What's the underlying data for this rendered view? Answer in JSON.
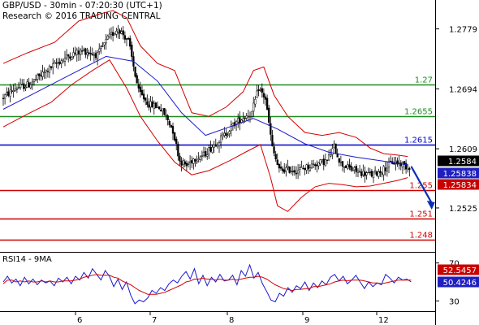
{
  "header": {
    "line1": "GBP/USD - 30min - 07:20:30 (UTC+1)",
    "line2": "Research © 2016 TRADING CENTRAL"
  },
  "colors": {
    "candles": "#000000",
    "bollinger_bands": "#d40000",
    "moving_average": "#1a1acc",
    "resistance_lines": "#1e8c1e",
    "pivot_line": "#0000cc",
    "support_lines": "#cc0000",
    "rsi": "#1a1acc",
    "rsi_ma": "#d40000",
    "price_tag": "#000000",
    "blue_tag": "#1f1fbf",
    "red_tag": "#c80000",
    "arrow": "#0a2fb5"
  },
  "chart_data": [
    {
      "type": "candlestick",
      "title": "",
      "y_axis": {
        "side": "right",
        "ticks": [
          1.2779,
          1.2694,
          1.2609,
          1.2525
        ],
        "tick_labels": [
          "1.2779",
          "1.2694",
          "1.2609",
          "1.2525"
        ],
        "range": [
          1.2465,
          1.282
        ]
      },
      "x_axis": {
        "categories": [
          "6",
          "7",
          "8",
          "9",
          "12"
        ]
      },
      "grid": false,
      "price_levels": [
        {
          "value": 1.27,
          "label": "1.27",
          "role": "resistance"
        },
        {
          "value": 1.2655,
          "label": "1.2655",
          "role": "resistance"
        },
        {
          "value": 1.2615,
          "label": "1.2615",
          "role": "pivot"
        },
        {
          "value": 1.255,
          "label": "1.255",
          "role": "support"
        },
        {
          "value": 1.251,
          "label": "1.251",
          "role": "support"
        },
        {
          "value": 1.248,
          "label": "1.248",
          "role": "support"
        }
      ],
      "price_tags": [
        {
          "label": "1.2584",
          "value": 1.2584,
          "style": "current-price"
        },
        {
          "label": "1.25838",
          "value": 1.25838,
          "style": "blue"
        },
        {
          "label": "1.25834",
          "value": 1.25834,
          "style": "red"
        }
      ],
      "price_path": [
        [
          0,
          1.268
        ],
        [
          8,
          1.2695
        ],
        [
          16,
          1.27
        ],
        [
          24,
          1.2715
        ],
        [
          32,
          1.273
        ],
        [
          40,
          1.2742
        ],
        [
          48,
          1.2748
        ],
        [
          56,
          1.2742
        ],
        [
          62,
          1.2765
        ],
        [
          68,
          1.278
        ],
        [
          74,
          1.2762
        ],
        [
          80,
          1.269
        ],
        [
          86,
          1.2672
        ],
        [
          92,
          1.2668
        ],
        [
          96,
          1.2655
        ],
        [
          100,
          1.2635
        ],
        [
          104,
          1.2592
        ],
        [
          108,
          1.2585
        ],
        [
          112,
          1.2595
        ],
        [
          118,
          1.26
        ],
        [
          124,
          1.2615
        ],
        [
          130,
          1.2628
        ],
        [
          136,
          1.2645
        ],
        [
          142,
          1.2655
        ],
        [
          146,
          1.266
        ],
        [
          150,
          1.2695
        ],
        [
          154,
          1.268
        ],
        [
          158,
          1.261
        ],
        [
          162,
          1.2578
        ],
        [
          166,
          1.258
        ],
        [
          172,
          1.2578
        ],
        [
          178,
          1.2583
        ],
        [
          184,
          1.2588
        ],
        [
          190,
          1.2592
        ],
        [
          194,
          1.2612
        ],
        [
          198,
          1.2588
        ],
        [
          204,
          1.258
        ],
        [
          210,
          1.2575
        ],
        [
          216,
          1.2572
        ],
        [
          222,
          1.2578
        ],
        [
          228,
          1.259
        ],
        [
          233,
          1.2588
        ],
        [
          236,
          1.2584
        ]
      ],
      "series": [
        {
          "name": "",
          "role": "moving-average",
          "points": [
            [
              0,
              1.2665
            ],
            [
              20,
              1.269
            ],
            [
              40,
              1.2715
            ],
            [
              60,
              1.274
            ],
            [
              76,
              1.2733
            ],
            [
              90,
              1.2705
            ],
            [
              104,
              1.266
            ],
            [
              118,
              1.2628
            ],
            [
              132,
              1.264
            ],
            [
              146,
              1.2652
            ],
            [
              160,
              1.2637
            ],
            [
              176,
              1.2616
            ],
            [
              190,
              1.2604
            ],
            [
              206,
              1.2597
            ],
            [
              220,
              1.2592
            ],
            [
              236,
              1.2586
            ]
          ]
        },
        {
          "name": "",
          "role": "bollinger-upper",
          "points": [
            [
              0,
              1.273
            ],
            [
              14,
              1.2745
            ],
            [
              30,
              1.276
            ],
            [
              44,
              1.279
            ],
            [
              56,
              1.28
            ],
            [
              64,
              1.2805
            ],
            [
              72,
              1.2795
            ],
            [
              80,
              1.2755
            ],
            [
              90,
              1.273
            ],
            [
              100,
              1.272
            ],
            [
              110,
              1.266
            ],
            [
              120,
              1.2655
            ],
            [
              130,
              1.2668
            ],
            [
              140,
              1.269
            ],
            [
              146,
              1.272
            ],
            [
              152,
              1.2725
            ],
            [
              158,
              1.2685
            ],
            [
              166,
              1.2655
            ],
            [
              176,
              1.2632
            ],
            [
              186,
              1.2628
            ],
            [
              196,
              1.2632
            ],
            [
              206,
              1.2625
            ],
            [
              214,
              1.261
            ],
            [
              222,
              1.2602
            ],
            [
              230,
              1.26
            ],
            [
              236,
              1.2598
            ]
          ]
        },
        {
          "name": "",
          "role": "bollinger-lower",
          "points": [
            [
              0,
              1.264
            ],
            [
              14,
              1.2658
            ],
            [
              28,
              1.2675
            ],
            [
              40,
              1.27
            ],
            [
              52,
              1.272
            ],
            [
              62,
              1.2735
            ],
            [
              72,
              1.2695
            ],
            [
              80,
              1.2655
            ],
            [
              90,
              1.262
            ],
            [
              100,
              1.259
            ],
            [
              110,
              1.2572
            ],
            [
              120,
              1.2578
            ],
            [
              132,
              1.2592
            ],
            [
              142,
              1.2605
            ],
            [
              150,
              1.2615
            ],
            [
              156,
              1.2568
            ],
            [
              160,
              1.2528
            ],
            [
              166,
              1.252
            ],
            [
              174,
              1.254
            ],
            [
              182,
              1.2555
            ],
            [
              190,
              1.256
            ],
            [
              198,
              1.2558
            ],
            [
              206,
              1.2555
            ],
            [
              214,
              1.2556
            ],
            [
              222,
              1.256
            ],
            [
              230,
              1.2564
            ],
            [
              236,
              1.2568
            ]
          ]
        }
      ],
      "forecast_arrow": {
        "from": [
          238,
          1.2584
        ],
        "to": [
          250,
          1.2525
        ]
      }
    },
    {
      "type": "line",
      "title": "RSI14 - 9MA",
      "y_axis": {
        "side": "right",
        "ticks": [
          70,
          30
        ],
        "tick_labels": [
          "70",
          "30"
        ],
        "range": [
          20,
          80
        ]
      },
      "series": [
        {
          "name": "RSI14",
          "role": "rsi",
          "values": [
            50,
            56,
            49,
            53,
            46,
            55,
            48,
            53,
            47,
            52,
            49,
            51,
            46,
            54,
            50,
            55,
            48,
            56,
            52,
            60,
            54,
            64,
            58,
            52,
            62,
            56,
            45,
            53,
            42,
            50,
            36,
            27,
            31,
            29,
            33,
            41,
            38,
            44,
            41,
            48,
            52,
            49,
            56,
            61,
            53,
            64,
            48,
            57,
            46,
            55,
            50,
            58,
            51,
            52,
            57,
            47,
            62,
            56,
            68,
            54,
            60,
            48,
            40,
            31,
            29,
            38,
            35,
            44,
            39,
            46,
            43,
            50,
            41,
            49,
            44,
            51,
            47,
            55,
            58,
            51,
            56,
            48,
            52,
            57,
            50,
            43,
            50,
            45,
            49,
            47,
            58,
            54,
            49,
            55,
            52,
            53,
            50
          ]
        },
        {
          "name": "9MA",
          "role": "rsi-ma",
          "values": [
            48,
            52,
            52,
            50,
            51,
            50,
            51,
            50,
            50,
            51,
            50,
            51,
            50,
            50,
            51,
            51,
            51,
            52,
            53,
            55,
            56,
            57,
            58,
            57,
            57,
            57,
            55,
            54,
            51,
            49,
            47,
            44,
            41,
            39,
            37,
            37,
            37,
            38,
            39,
            41,
            43,
            45,
            47,
            50,
            51,
            53,
            53,
            54,
            53,
            53,
            52,
            53,
            52,
            52,
            53,
            52,
            53,
            54,
            55,
            55,
            56,
            55,
            53,
            50,
            47,
            45,
            43,
            42,
            41,
            42,
            42,
            43,
            43,
            45,
            45,
            46,
            47,
            48,
            50,
            51,
            52,
            51,
            52,
            52,
            52,
            51,
            50,
            49,
            49,
            48,
            49,
            50,
            51,
            52,
            52,
            52,
            52
          ]
        }
      ],
      "value_tags": [
        {
          "label": "52.5457",
          "value": 52.5457,
          "style": "red"
        },
        {
          "label": "50.4246",
          "value": 50.4246,
          "style": "blue"
        }
      ]
    }
  ]
}
